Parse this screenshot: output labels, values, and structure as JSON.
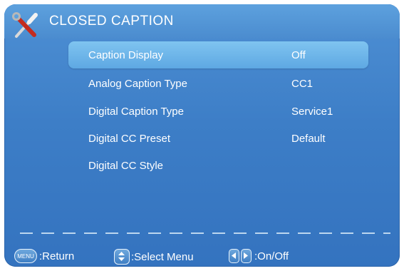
{
  "header": {
    "title": "CLOSED CAPTION",
    "icon": "tools-icon"
  },
  "menu": [
    {
      "label": "Caption Display",
      "value": "Off",
      "selected": true
    },
    {
      "label": "Analog Caption Type",
      "value": "CC1"
    },
    {
      "label": "Digital Caption Type",
      "value": "Service1"
    },
    {
      "label": "Digital CC Preset",
      "value": "Default"
    },
    {
      "label": "Digital CC Style",
      "value": ""
    }
  ],
  "footer": {
    "menu_key_label": "MENU",
    "return_label": ":Return",
    "select_label": ":Select Menu",
    "onoff_label": ":On/Off"
  },
  "colors": {
    "background": "#3d7ec7",
    "highlight": "#6fb6ea",
    "text": "#ffffff"
  }
}
